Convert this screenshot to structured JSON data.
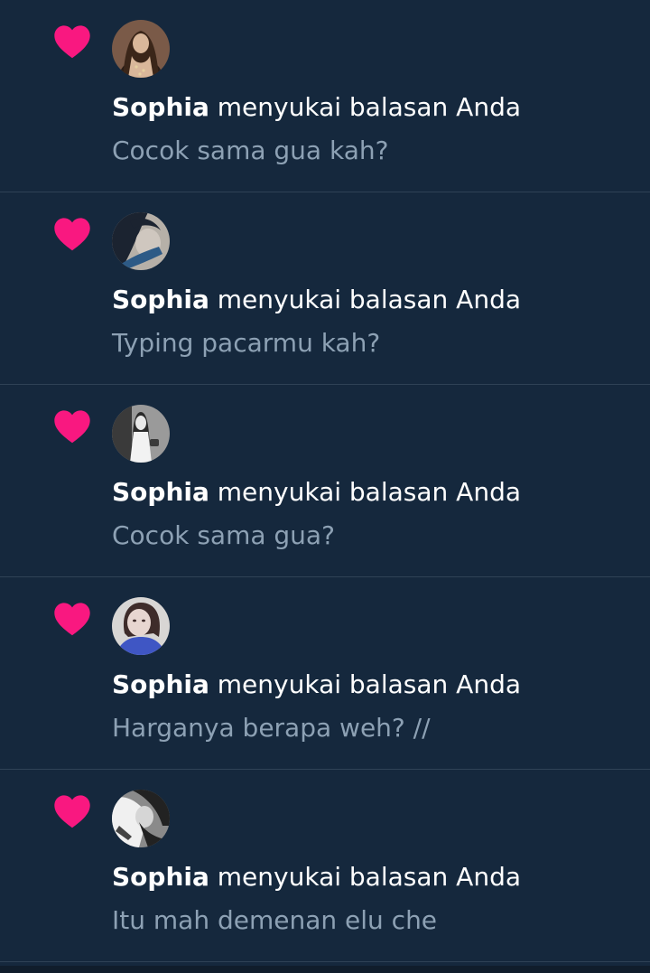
{
  "theme": {
    "background": "#15283d",
    "divider": "#2f4256",
    "heart_color": "#f91880",
    "primary_text": "#ffffff",
    "secondary_text": "#8da1b4"
  },
  "notifications": [
    {
      "icon": "heart-icon",
      "user": "Sophia",
      "action": "menyukai balasan Anda",
      "preview": "Cocok sama gua kah?",
      "avatar_colors": [
        "#6b4a3a",
        "#d9b79a",
        "#2a1d17"
      ]
    },
    {
      "icon": "heart-icon",
      "user": "Sophia",
      "action": "menyukai balasan Anda",
      "preview": "Typing pacarmu kah?",
      "avatar_colors": [
        "#b6b0a8",
        "#1b2330",
        "#2d5a86"
      ]
    },
    {
      "icon": "heart-icon",
      "user": "Sophia",
      "action": "menyukai balasan Anda",
      "preview": "Cocok sama gua?",
      "avatar_colors": [
        "#e8e8e8",
        "#3a3a3a",
        "#9a9a9a"
      ]
    },
    {
      "icon": "heart-icon",
      "user": "Sophia",
      "action": "menyukai balasan Anda",
      "preview": "Harganya berapa weh? //",
      "avatar_colors": [
        "#e7d6d0",
        "#3e2c2a",
        "#3f56c4"
      ]
    },
    {
      "icon": "heart-icon",
      "user": "Sophia",
      "action": "menyukai balasan Anda",
      "preview": "Itu mah demenan elu che",
      "avatar_colors": [
        "#f0f0f0",
        "#222222",
        "#8a8a8a"
      ]
    }
  ]
}
